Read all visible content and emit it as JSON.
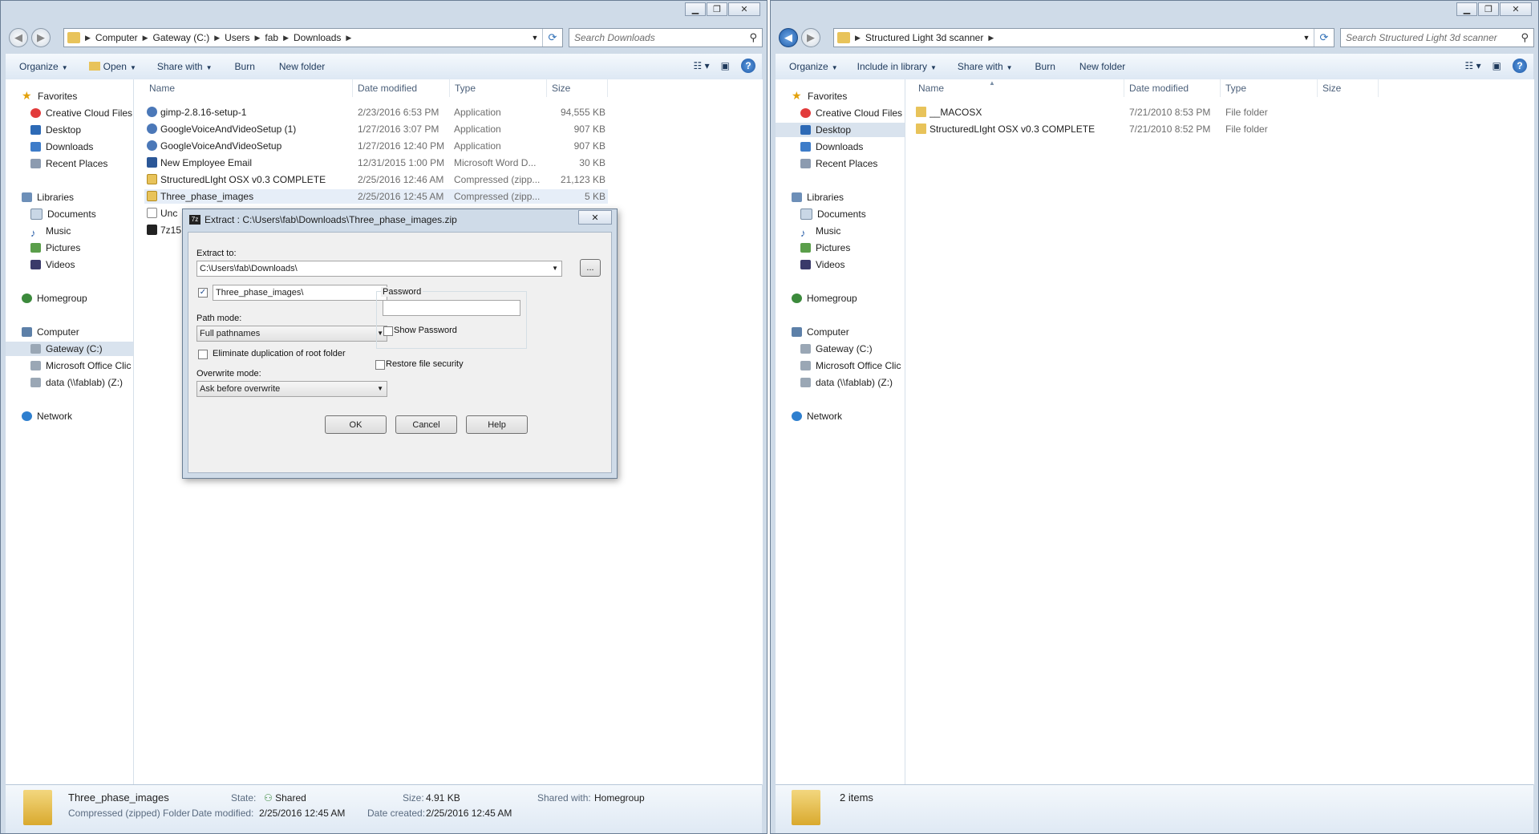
{
  "left_window": {
    "address": {
      "crumbs": [
        "Computer",
        "Gateway (C:)",
        "Users",
        "fab",
        "Downloads"
      ]
    },
    "search_placeholder": "Search Downloads",
    "toolbar": {
      "organize": "Organize",
      "open": "Open",
      "share_with": "Share with",
      "burn": "Burn",
      "new_folder": "New folder"
    },
    "nav": {
      "favorites": "Favorites",
      "creative_cloud": "Creative Cloud Files",
      "desktop": "Desktop",
      "downloads": "Downloads",
      "recent_places": "Recent Places",
      "libraries": "Libraries",
      "documents": "Documents",
      "music": "Music",
      "pictures": "Pictures",
      "videos": "Videos",
      "homegroup": "Homegroup",
      "computer": "Computer",
      "gateway": "Gateway (C:)",
      "ms_office": "Microsoft Office Clic",
      "data_drive": "data (\\\\fablab) (Z:)",
      "network": "Network"
    },
    "columns": {
      "name": "Name",
      "date": "Date modified",
      "type": "Type",
      "size": "Size"
    },
    "files": [
      {
        "name": "gimp-2.8.16-setup-1",
        "date": "2/23/2016 6:53 PM",
        "type": "Application",
        "size": "94,555 KB"
      },
      {
        "name": "GoogleVoiceAndVideoSetup (1)",
        "date": "1/27/2016 3:07 PM",
        "type": "Application",
        "size": "907 KB"
      },
      {
        "name": "GoogleVoiceAndVideoSetup",
        "date": "1/27/2016 12:40 PM",
        "type": "Application",
        "size": "907 KB"
      },
      {
        "name": "New Employee Email",
        "date": "12/31/2015 1:00 PM",
        "type": "Microsoft Word D...",
        "size": "30 KB"
      },
      {
        "name": "StructuredLIght OSX v0.3 COMPLETE",
        "date": "2/25/2016 12:46 AM",
        "type": "Compressed (zipp...",
        "size": "21,123 KB"
      },
      {
        "name": "Three_phase_images",
        "date": "2/25/2016 12:45 AM",
        "type": "Compressed (zipp...",
        "size": "5 KB"
      },
      {
        "name": "Unc",
        "date": "",
        "type": "",
        "size": ""
      },
      {
        "name": "7z15",
        "date": "",
        "type": "",
        "size": ""
      }
    ],
    "details": {
      "name": "Three_phase_images",
      "kind": "Compressed (zipped) Folder",
      "state_label": "State:",
      "state": "Shared",
      "size_label": "Size:",
      "size": "4.91 KB",
      "shared_label": "Shared with:",
      "shared": "Homegroup",
      "modified_label": "Date modified:",
      "modified": "2/25/2016 12:45 AM",
      "created_label": "Date created:",
      "created": "2/25/2016 12:45 AM"
    }
  },
  "right_window": {
    "address": {
      "crumbs": [
        "Structured Light 3d scanner"
      ]
    },
    "search_placeholder": "Search Structured Light 3d scanner",
    "toolbar": {
      "organize": "Organize",
      "include": "Include in library",
      "share_with": "Share with",
      "burn": "Burn",
      "new_folder": "New folder"
    },
    "nav": {
      "favorites": "Favorites",
      "creative_cloud": "Creative Cloud Files",
      "desktop": "Desktop",
      "downloads": "Downloads",
      "recent_places": "Recent Places",
      "libraries": "Libraries",
      "documents": "Documents",
      "music": "Music",
      "pictures": "Pictures",
      "videos": "Videos",
      "homegroup": "Homegroup",
      "computer": "Computer",
      "gateway": "Gateway (C:)",
      "ms_office": "Microsoft Office Clic",
      "data_drive": "data (\\\\fablab) (Z:)",
      "network": "Network"
    },
    "columns": {
      "name": "Name",
      "date": "Date modified",
      "type": "Type",
      "size": "Size"
    },
    "files": [
      {
        "name": "__MACOSX",
        "date": "7/21/2010 8:53 PM",
        "type": "File folder"
      },
      {
        "name": "StructuredLIght OSX v0.3 COMPLETE",
        "date": "7/21/2010 8:52 PM",
        "type": "File folder"
      }
    ],
    "details": {
      "count": "2 items"
    }
  },
  "dialog": {
    "title": "Extract : C:\\Users\\fab\\Downloads\\Three_phase_images.zip",
    "extract_to_label": "Extract to:",
    "extract_to_value": "C:\\Users\\fab\\Downloads\\",
    "browse_label": "...",
    "subfolder_value": "Three_phase_images\\",
    "subfolder_checked": true,
    "path_mode_label": "Path mode:",
    "path_mode_value": "Full pathnames",
    "eliminate_label": "Eliminate duplication of root folder",
    "overwrite_label": "Overwrite mode:",
    "overwrite_value": "Ask before overwrite",
    "password_label": "Password",
    "show_password_label": "Show Password",
    "restore_security_label": "Restore file security",
    "ok": "OK",
    "cancel": "Cancel",
    "help": "Help",
    "checkmark": "✓"
  },
  "icons": {
    "back": "back-arrow-icon",
    "forward": "forward-arrow-icon",
    "search": "search-icon",
    "help": "help-icon",
    "close": "close-icon"
  }
}
